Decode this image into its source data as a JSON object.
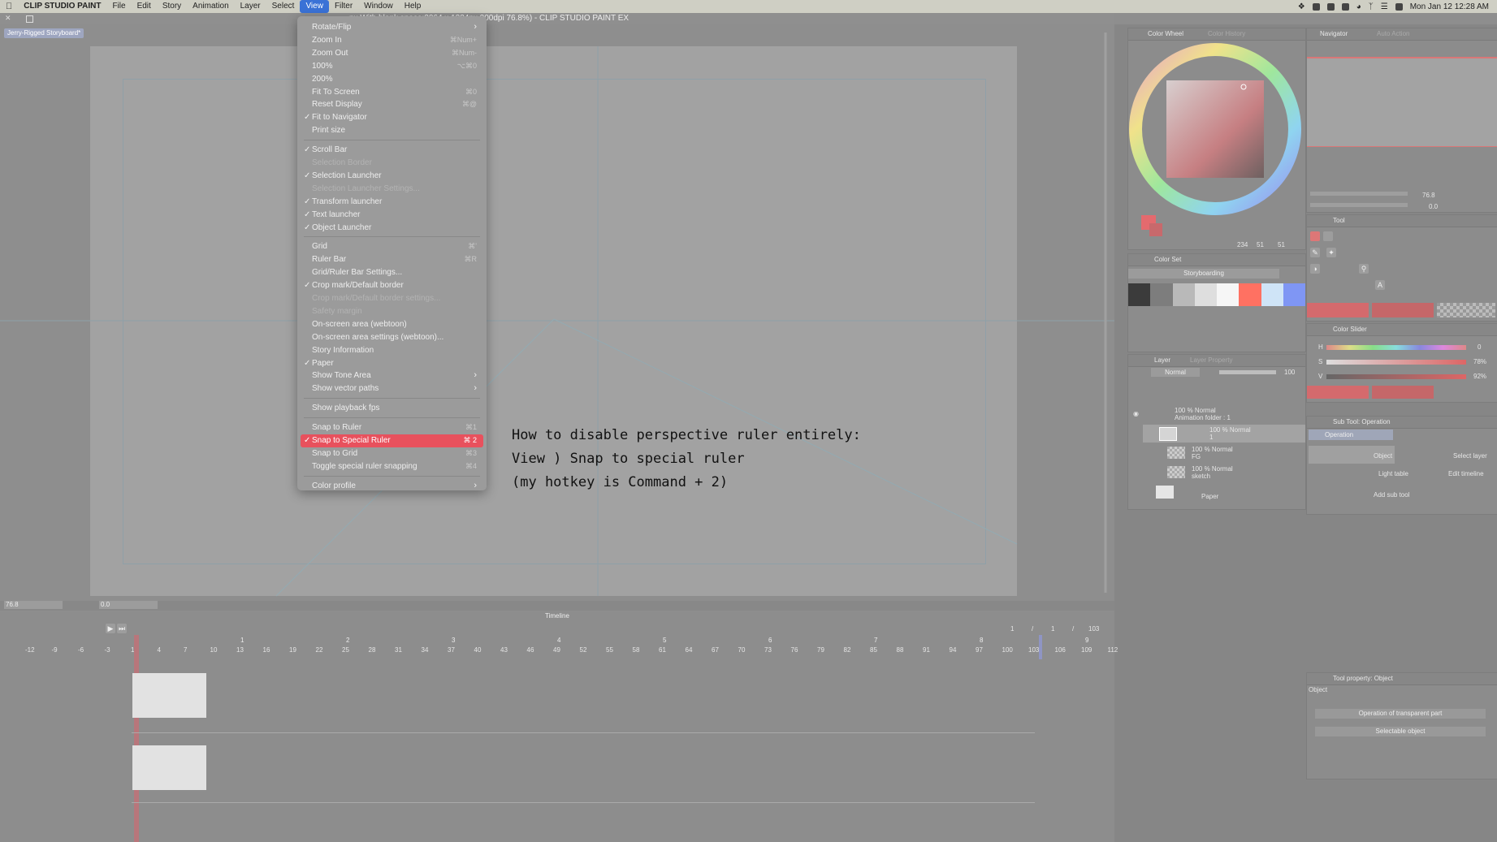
{
  "menubar": {
    "app_name": "CLIP STUDIO PAINT",
    "items": [
      "File",
      "Edit",
      "Story",
      "Animation",
      "Layer",
      "Select",
      "View",
      "Filter",
      "Window",
      "Help"
    ],
    "active_item": "View",
    "clock": "Mon Jan 12  12:28 AM"
  },
  "window": {
    "title": "px With blank space:2064 x 1224px 200dpi 76.8%)  - CLIP STUDIO PAINT EX",
    "doc_tab": "Jerry-Rigged Storyboard*"
  },
  "view_menu": {
    "items": [
      {
        "label": "Rotate/Flip",
        "shortcut": "",
        "checked": false,
        "disabled": false,
        "submenu": true
      },
      {
        "label": "Zoom In",
        "shortcut": "⌘Num+",
        "checked": false,
        "disabled": false,
        "submenu": false
      },
      {
        "label": "Zoom Out",
        "shortcut": "⌘Num-",
        "checked": false,
        "disabled": false,
        "submenu": false
      },
      {
        "label": "100%",
        "shortcut": "⌥⌘0",
        "checked": false,
        "disabled": false,
        "submenu": false
      },
      {
        "label": "200%",
        "shortcut": "",
        "checked": false,
        "disabled": false,
        "submenu": false
      },
      {
        "label": "Fit To Screen",
        "shortcut": "⌘0",
        "checked": false,
        "disabled": false,
        "submenu": false
      },
      {
        "label": "Reset Display",
        "shortcut": "⌘@",
        "checked": false,
        "disabled": false,
        "submenu": false
      },
      {
        "label": "Fit to Navigator",
        "shortcut": "",
        "checked": true,
        "disabled": false,
        "submenu": false
      },
      {
        "label": "Print size",
        "shortcut": "",
        "checked": false,
        "disabled": false,
        "submenu": false
      },
      {
        "sep": true
      },
      {
        "label": "Scroll Bar",
        "shortcut": "",
        "checked": true,
        "disabled": false,
        "submenu": false
      },
      {
        "label": "Selection Border",
        "shortcut": "",
        "checked": false,
        "disabled": true,
        "submenu": false
      },
      {
        "label": "Selection Launcher",
        "shortcut": "",
        "checked": true,
        "disabled": false,
        "submenu": false
      },
      {
        "label": "Selection Launcher Settings...",
        "shortcut": "",
        "checked": false,
        "disabled": true,
        "submenu": false
      },
      {
        "label": "Transform launcher",
        "shortcut": "",
        "checked": true,
        "disabled": false,
        "submenu": false
      },
      {
        "label": "Text launcher",
        "shortcut": "",
        "checked": true,
        "disabled": false,
        "submenu": false
      },
      {
        "label": "Object Launcher",
        "shortcut": "",
        "checked": true,
        "disabled": false,
        "submenu": false
      },
      {
        "sep": true
      },
      {
        "label": "Grid",
        "shortcut": "⌘'",
        "checked": false,
        "disabled": false,
        "submenu": false
      },
      {
        "label": "Ruler Bar",
        "shortcut": "⌘R",
        "checked": false,
        "disabled": false,
        "submenu": false
      },
      {
        "label": "Grid/Ruler Bar Settings...",
        "shortcut": "",
        "checked": false,
        "disabled": false,
        "submenu": false
      },
      {
        "label": "Crop mark/Default border",
        "shortcut": "",
        "checked": true,
        "disabled": false,
        "submenu": false
      },
      {
        "label": "Crop mark/Default border settings...",
        "shortcut": "",
        "checked": false,
        "disabled": true,
        "submenu": false
      },
      {
        "label": "Safety margin",
        "shortcut": "",
        "checked": false,
        "disabled": true,
        "submenu": false
      },
      {
        "label": "On-screen area (webtoon)",
        "shortcut": "",
        "checked": false,
        "disabled": false,
        "submenu": false
      },
      {
        "label": "On-screen area settings (webtoon)...",
        "shortcut": "",
        "checked": false,
        "disabled": false,
        "submenu": false
      },
      {
        "label": "Story Information",
        "shortcut": "",
        "checked": false,
        "disabled": false,
        "submenu": false
      },
      {
        "label": "Paper",
        "shortcut": "",
        "checked": true,
        "disabled": false,
        "submenu": false
      },
      {
        "label": "Show Tone Area",
        "shortcut": "",
        "checked": false,
        "disabled": false,
        "submenu": true
      },
      {
        "label": "Show vector paths",
        "shortcut": "",
        "checked": false,
        "disabled": false,
        "submenu": true
      },
      {
        "sep": true
      },
      {
        "label": "Show playback fps",
        "shortcut": "",
        "checked": false,
        "disabled": false,
        "submenu": false
      },
      {
        "sep": true
      },
      {
        "label": "Snap to Ruler",
        "shortcut": "⌘1",
        "checked": false,
        "disabled": false,
        "submenu": false
      },
      {
        "label": "Snap to Special Ruler",
        "shortcut": "⌘ 2",
        "checked": true,
        "disabled": false,
        "submenu": false,
        "highlighted": true
      },
      {
        "label": "Snap to Grid",
        "shortcut": "⌘3",
        "checked": false,
        "disabled": false,
        "submenu": false
      },
      {
        "label": "Toggle special ruler snapping",
        "shortcut": "⌘4",
        "checked": false,
        "disabled": false,
        "submenu": false
      },
      {
        "sep": true
      },
      {
        "label": "Color profile",
        "shortcut": "",
        "checked": false,
        "disabled": false,
        "submenu": true
      }
    ]
  },
  "annotation": {
    "line1": "How to disable perspective ruler entirely:",
    "line2": "View ) Snap  to special ruler",
    "line3": "(my hotkey is Command + 2)"
  },
  "color_wheel": {
    "tab1": "Color Wheel",
    "tab2": "Color History",
    "h": "234",
    "s": "51",
    "v": "51",
    "main_color": "#e46a6e"
  },
  "navigator": {
    "tab1": "Navigator",
    "tab2": "Auto Action",
    "zoom": "76.8",
    "angle": "0.0"
  },
  "color_set": {
    "title": "Color Set",
    "set_name": "Storyboarding",
    "swatches": [
      "#3b3b3b",
      "#7d7d7d",
      "#b9b9b9",
      "#dedede",
      "#f6f6f6",
      "#ff7162",
      "#cfe4f7",
      "#7f96f4"
    ]
  },
  "tool": {
    "title": "Tool"
  },
  "color_slider": {
    "title": "Color Slider",
    "h_label": "H",
    "s_label": "S",
    "v_label": "V",
    "h_value": "0",
    "s_value": "78%",
    "v_value": "92%"
  },
  "layer": {
    "tab1": "Layer",
    "tab2": "Layer Property",
    "blend_mode": "Normal",
    "opacity": "100",
    "rows": [
      {
        "line1": "100 % Normal",
        "line2": "Animation folder : 1"
      },
      {
        "line1": "100 % Normal",
        "line2": "1"
      },
      {
        "line1": "100 % Normal",
        "line2": "FG"
      },
      {
        "line1": "100 % Normal",
        "line2": "sketch"
      },
      {
        "line1": "",
        "line2": "Paper"
      }
    ]
  },
  "sub_tool": {
    "title": "Sub Tool: Operation",
    "tab": "Operation",
    "items": [
      {
        "label": "Object"
      },
      {
        "label": "Select layer"
      },
      {
        "label": "Light table"
      },
      {
        "label": "Edit timeline"
      }
    ],
    "add_label": "Add sub tool"
  },
  "tool_property": {
    "title": "Tool property: Object",
    "section": "Object",
    "dropdown1": "Operation of transparent part",
    "dropdown2": "Selectable object"
  },
  "timeline": {
    "title": "Timeline",
    "counter": {
      "current": "1",
      "slash1": "/",
      "mid": "1",
      "slash2": "/",
      "total": "103"
    },
    "frames": [
      "-12",
      "-9",
      "-6",
      "-3",
      "1",
      "4",
      "7",
      "10",
      "13",
      "16",
      "19",
      "22",
      "25",
      "28",
      "31",
      "34",
      "37",
      "40",
      "43",
      "46",
      "49",
      "52",
      "55",
      "58",
      "61",
      "64",
      "67",
      "70",
      "73",
      "76",
      "79",
      "82",
      "85",
      "88",
      "91",
      "94",
      "97",
      "100",
      "103",
      "106",
      "109",
      "112"
    ],
    "seconds": [
      "1",
      "2",
      "3",
      "4",
      "5",
      "6",
      "7",
      "8",
      "9"
    ]
  },
  "statusbar": {
    "zoom": "76.8",
    "angle": "0.0"
  }
}
